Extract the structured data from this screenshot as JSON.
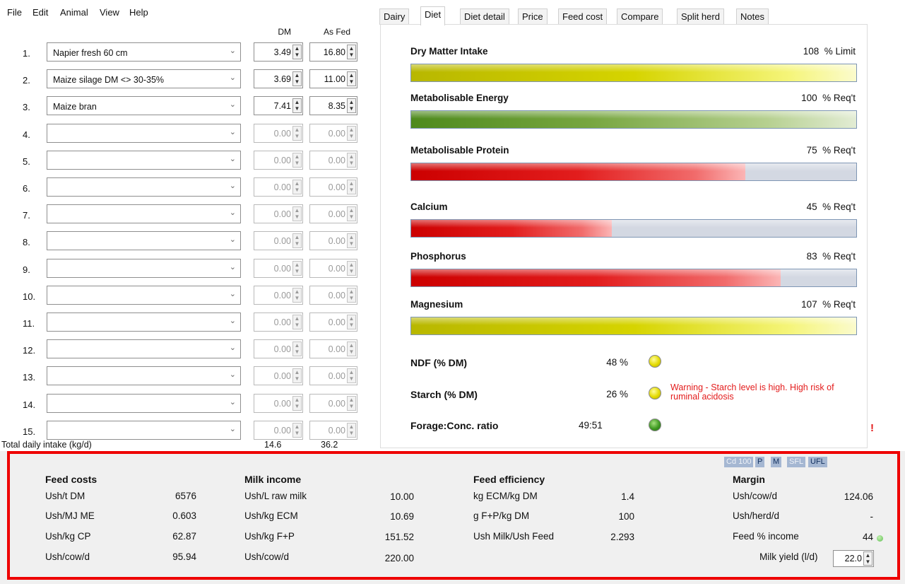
{
  "menu": [
    "File",
    "Edit",
    "Animal",
    "View",
    "Help"
  ],
  "columns": {
    "dm": "DM",
    "as_fed": "As Fed"
  },
  "rows": [
    {
      "num": "1.",
      "feed": "Napier fresh 60 cm",
      "dm": "3.49",
      "as_fed": "16.80",
      "active": true
    },
    {
      "num": "2.",
      "feed": "Maize silage DM <> 30-35%",
      "dm": "3.69",
      "as_fed": "11.00",
      "active": true
    },
    {
      "num": "3.",
      "feed": "Maize bran",
      "dm": "7.41",
      "as_fed": "8.35",
      "active": true
    },
    {
      "num": "4.",
      "feed": "",
      "dm": "0.00",
      "as_fed": "0.00",
      "active": false
    },
    {
      "num": "5.",
      "feed": "",
      "dm": "0.00",
      "as_fed": "0.00",
      "active": false
    },
    {
      "num": "6.",
      "feed": "",
      "dm": "0.00",
      "as_fed": "0.00",
      "active": false
    },
    {
      "num": "7.",
      "feed": "",
      "dm": "0.00",
      "as_fed": "0.00",
      "active": false
    },
    {
      "num": "8.",
      "feed": "",
      "dm": "0.00",
      "as_fed": "0.00",
      "active": false
    },
    {
      "num": "9.",
      "feed": "",
      "dm": "0.00",
      "as_fed": "0.00",
      "active": false
    },
    {
      "num": "10.",
      "feed": "",
      "dm": "0.00",
      "as_fed": "0.00",
      "active": false
    },
    {
      "num": "11.",
      "feed": "",
      "dm": "0.00",
      "as_fed": "0.00",
      "active": false
    },
    {
      "num": "12.",
      "feed": "",
      "dm": "0.00",
      "as_fed": "0.00",
      "active": false
    },
    {
      "num": "13.",
      "feed": "",
      "dm": "0.00",
      "as_fed": "0.00",
      "active": false
    },
    {
      "num": "14.",
      "feed": "",
      "dm": "0.00",
      "as_fed": "0.00",
      "active": false
    },
    {
      "num": "15.",
      "feed": "",
      "dm": "0.00",
      "as_fed": "0.00",
      "active": false
    }
  ],
  "total": {
    "label": "Total daily intake (kg/d)",
    "dm": "14.6",
    "as_fed": "36.2"
  },
  "tabs": [
    "Dairy",
    "Diet",
    "Diet detail",
    "Price",
    "Feed cost",
    "Compare",
    "Split herd",
    "Notes"
  ],
  "active_tab": "Diet",
  "gauges": [
    {
      "title": "Dry Matter Intake",
      "value": "108",
      "unit": "% Limit",
      "percent": 108,
      "color": "yellow"
    },
    {
      "title": "Metabolisable Energy",
      "value": "100",
      "unit": "% Req't",
      "percent": 100,
      "color": "green"
    },
    {
      "title": "Metabolisable Protein",
      "value": "75",
      "unit": "% Req't",
      "percent": 75,
      "color": "red"
    },
    {
      "title": "Calcium",
      "value": "45",
      "unit": "% Req't",
      "percent": 45,
      "color": "red"
    },
    {
      "title": "Phosphorus",
      "value": "83",
      "unit": "% Req't",
      "percent": 83,
      "color": "red"
    },
    {
      "title": "Magnesium",
      "value": "107",
      "unit": "% Req't",
      "percent": 107,
      "color": "yellow"
    }
  ],
  "indicators": [
    {
      "label": "NDF (% DM)",
      "value": "48 %",
      "status": "yellow"
    },
    {
      "label": "Starch (% DM)",
      "value": "26 %",
      "status": "yellow",
      "warning": "Warning - Starch level is high. High risk of ruminal acidosis"
    },
    {
      "label": "Forage:Conc. ratio",
      "value": "49:51",
      "status": "green"
    }
  ],
  "alert_mark": "!",
  "badges": [
    "Cd 100",
    "P",
    "M",
    "SFL",
    "UFL"
  ],
  "summary": {
    "feed_costs": {
      "title": "Feed costs",
      "items": [
        {
          "label": "Ush/t DM",
          "value": "6576"
        },
        {
          "label": "Ush/MJ ME",
          "value": "0.603"
        },
        {
          "label": "Ush/kg CP",
          "value": "62.87"
        },
        {
          "label": "Ush/cow/d",
          "value": "95.94"
        }
      ]
    },
    "milk_income": {
      "title": "Milk income",
      "items": [
        {
          "label": "Ush/L raw milk",
          "value": "10.00"
        },
        {
          "label": "Ush/kg ECM",
          "value": "10.69"
        },
        {
          "label": "Ush/kg F+P",
          "value": "151.52"
        },
        {
          "label": "Ush/cow/d",
          "value": "220.00"
        }
      ]
    },
    "feed_efficiency": {
      "title": "Feed efficiency",
      "items": [
        {
          "label": "kg ECM/kg DM",
          "value": "1.4"
        },
        {
          "label": "g F+P/kg DM",
          "value": "100"
        },
        {
          "label": "Ush Milk/Ush Feed",
          "value": "2.293"
        }
      ]
    },
    "margin": {
      "title": "Margin",
      "items": [
        {
          "label": "Ush/cow/d",
          "value": "124.06"
        },
        {
          "label": "Ush/herd/d",
          "value": "-"
        },
        {
          "label": "Feed % income",
          "value": "44"
        }
      ],
      "milk_yield_label": "Milk yield (l/d)",
      "milk_yield_value": "22.0"
    }
  },
  "colors": {
    "alert_red": "#ee0000",
    "bar_yellow": "#d6d400",
    "bar_green": "#77a640",
    "bar_red": "#e21d1d",
    "bar_track": "#d3d8e2"
  }
}
